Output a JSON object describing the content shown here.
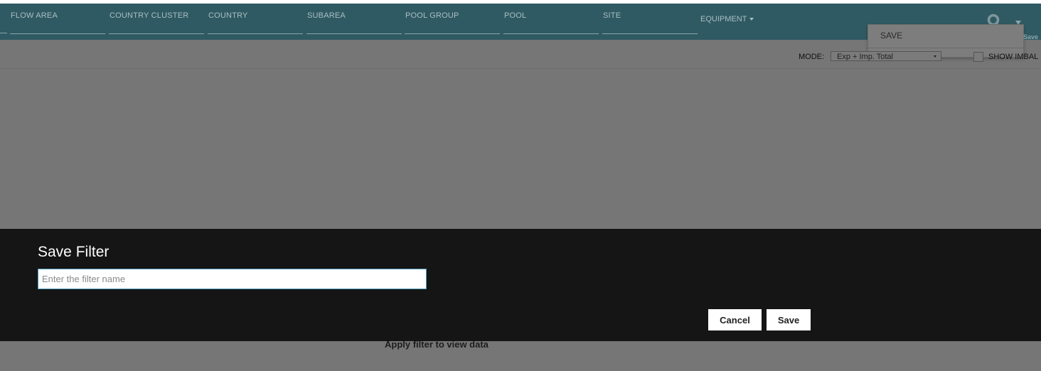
{
  "filters": [
    {
      "label": "FLOW AREA"
    },
    {
      "label": "COUNTRY CLUSTER"
    },
    {
      "label": "COUNTRY"
    },
    {
      "label": "SUBAREA"
    },
    {
      "label": "POOL GROUP"
    },
    {
      "label": "POOL"
    },
    {
      "label": "SITE"
    }
  ],
  "equipment": {
    "label": "EQUIPMENT"
  },
  "save_menu": {
    "item": "SAVE",
    "partial_label": "Save"
  },
  "toolbar": {
    "mode_label": "MODE:",
    "mode_value": "Exp + Imp. Total",
    "imbalance_label": "SHOW IMBAL"
  },
  "modal": {
    "title": "Save Filter",
    "input_placeholder": "Enter the filter name",
    "input_value": "",
    "cancel_label": "Cancel",
    "save_label": "Save"
  },
  "empty_message": "Apply filter to view data",
  "colors": {
    "header": "#305a63",
    "overlay": "#767676",
    "modal": "#151515",
    "input_border": "#4a98b6"
  }
}
